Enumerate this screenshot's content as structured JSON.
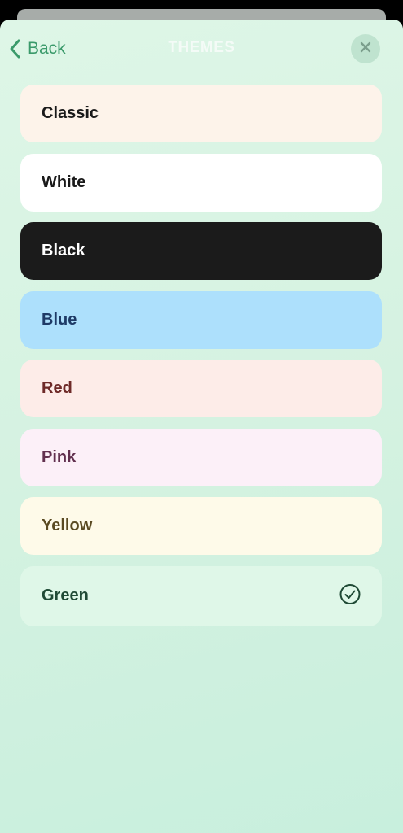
{
  "nav": {
    "back_label": "Back",
    "title": "THEMES",
    "back_icon": "chevron-left-icon",
    "close_icon": "close-icon"
  },
  "themes": [
    {
      "label": "Classic",
      "bg": "#fdf3ea",
      "fg": "#1a1a1a",
      "selected": false
    },
    {
      "label": "White",
      "bg": "#ffffff",
      "fg": "#1a1a1a",
      "selected": false
    },
    {
      "label": "Black",
      "bg": "#1b1b1b",
      "fg": "#ffffff",
      "selected": false
    },
    {
      "label": "Blue",
      "bg": "#ade0fc",
      "fg": "#1e3a66",
      "selected": false
    },
    {
      "label": "Red",
      "bg": "#fdece8",
      "fg": "#6e2a28",
      "selected": false
    },
    {
      "label": "Pink",
      "bg": "#fcf0f8",
      "fg": "#62304f",
      "selected": false
    },
    {
      "label": "Yellow",
      "bg": "#fefae9",
      "fg": "#5a4a22",
      "selected": false
    },
    {
      "label": "Green",
      "bg": "#dff7e8",
      "fg": "#1f4a35",
      "selected": true
    }
  ],
  "selected_icon": "check-circle-icon"
}
